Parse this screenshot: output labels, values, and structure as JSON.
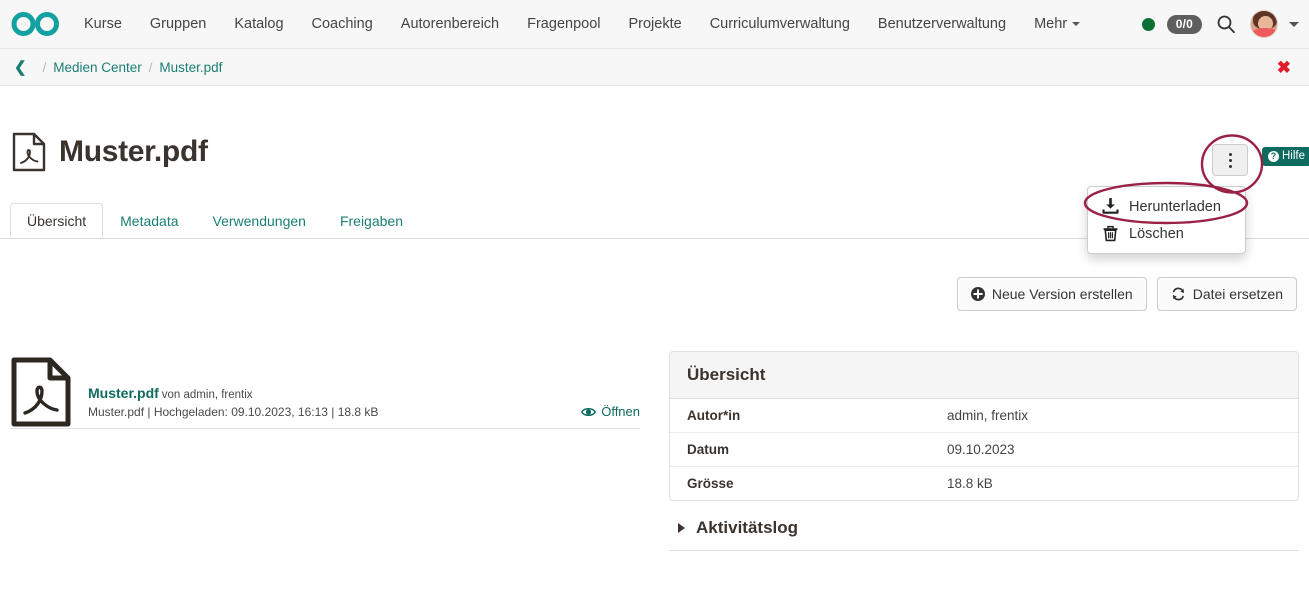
{
  "colors": {
    "brand_teal": "#12a0a0",
    "link_teal": "#1a7f72",
    "accent_dark_teal": "#0e6b60",
    "annotation": "#9b2045",
    "status_green": "#0a7034",
    "close_red": "#e01b2b",
    "badge_gray": "#5e5e5e"
  },
  "topnav": {
    "logo_icon": "infinity-logo-icon",
    "items": [
      {
        "label": "Kurse"
      },
      {
        "label": "Gruppen"
      },
      {
        "label": "Katalog"
      },
      {
        "label": "Coaching"
      },
      {
        "label": "Autorenbereich"
      },
      {
        "label": "Fragenpool"
      },
      {
        "label": "Projekte"
      },
      {
        "label": "Curriculumverwaltung"
      },
      {
        "label": "Benutzerverwaltung"
      },
      {
        "label": "Mehr"
      }
    ],
    "status_indicator": "online-status-dot",
    "count_badge": "0/0",
    "search_icon": "search-icon",
    "avatar_icon": "user-avatar",
    "avatar_caret_icon": "chevron-down-icon"
  },
  "breadcrumb": {
    "back_icon": "chevron-left-icon",
    "separator": "/",
    "items": [
      {
        "label": "Medien Center"
      },
      {
        "label": "Muster.pdf"
      }
    ],
    "close_icon": "close-x-icon",
    "close_glyph": "✖"
  },
  "page_header": {
    "file_icon": "pdf-file-icon",
    "title": "Muster.pdf",
    "kebab_icon": "more-options-vertical-icon",
    "help": {
      "label": "Hilfe",
      "icon": "question-mark-icon",
      "glyph": "?"
    }
  },
  "dropdown": {
    "visible": true,
    "items": [
      {
        "label": "Herunterladen",
        "icon": "download-icon"
      },
      {
        "label": "Löschen",
        "icon": "trash-icon"
      }
    ]
  },
  "annotations": [
    {
      "name": "kebab-highlight-ellipse",
      "shape": "ellipse"
    },
    {
      "name": "herunterladen-highlight-ellipse",
      "shape": "ellipse"
    }
  ],
  "tabs": {
    "active": "Übersicht",
    "items": [
      {
        "label": "Übersicht"
      },
      {
        "label": "Metadata"
      },
      {
        "label": "Verwendungen"
      },
      {
        "label": "Freigaben"
      }
    ]
  },
  "actions": [
    {
      "label": "Neue Version erstellen",
      "icon": "plus-circle-icon"
    },
    {
      "label": "Datei ersetzen",
      "icon": "refresh-icon"
    }
  ],
  "file_panel": {
    "thumbnail_icon": "pdf-file-icon",
    "name": "Muster.pdf",
    "author_prefix": "von admin, frentix",
    "details": "Muster.pdf | Hochgeladen: 09.10.2023, 16:13 | 18.8 kB",
    "open_link": {
      "label": "Öffnen",
      "icon": "eye-icon"
    }
  },
  "overview_panel": {
    "title": "Übersicht",
    "rows": [
      {
        "key": "Autor*in",
        "value": "admin, frentix"
      },
      {
        "key": "Datum",
        "value": "09.10.2023"
      },
      {
        "key": "Grösse",
        "value": "18.8 kB"
      }
    ]
  },
  "activity_log": {
    "title": "Aktivitätslog",
    "expanded": false,
    "caret_icon": "caret-right-icon"
  }
}
